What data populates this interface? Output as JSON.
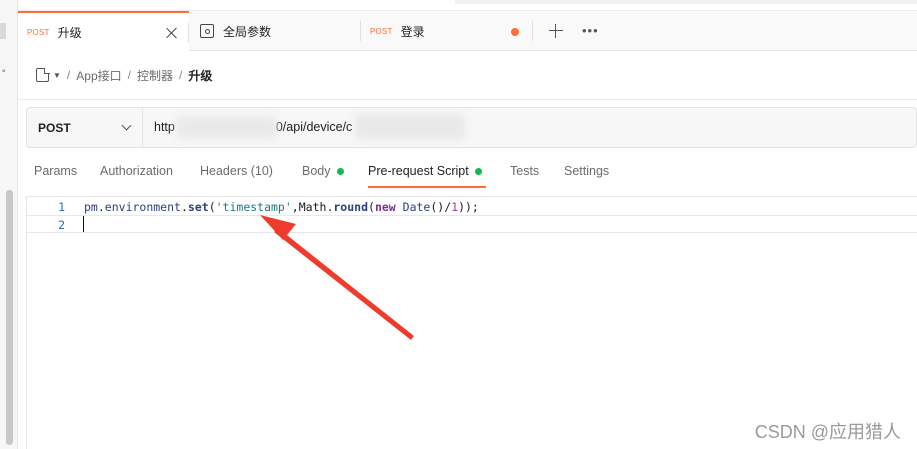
{
  "tabs": [
    {
      "method": "POST",
      "label": "升级",
      "active": true
    },
    {
      "label": "全局参数"
    },
    {
      "method": "POST",
      "label": "登录",
      "unsaved": true
    }
  ],
  "breadcrumb": {
    "items": [
      "App接口",
      "控制器"
    ],
    "current": "升级",
    "separator": "/"
  },
  "request": {
    "method": "POST",
    "url_start": "http",
    "url_middle": "0/api/device/c"
  },
  "request_tabs": [
    {
      "label": "Params"
    },
    {
      "label": "Authorization"
    },
    {
      "label": "Headers (10)"
    },
    {
      "label": "Body",
      "dot": true
    },
    {
      "label": "Pre-request Script",
      "dot": true,
      "active": true
    },
    {
      "label": "Tests"
    },
    {
      "label": "Settings"
    }
  ],
  "editor": {
    "line_numbers": [
      "1",
      "2"
    ],
    "code": {
      "obj": "pm",
      "dot1": ".",
      "prop1": "environment",
      "dot2": ".",
      "prop2": "set",
      "open": "(",
      "str": "'timestamp'",
      "comma": ",",
      "math": "Math",
      "dot3": ".",
      "prop3": "round",
      "open2": "(",
      "kw": "new",
      "cls": " Date",
      "parens": "()",
      "slash": "/",
      "num": "1",
      "close": "));"
    }
  },
  "watermark": "CSDN @应用猎人",
  "colors": {
    "accent": "#ff6c37",
    "green_dot": "#0cbb52",
    "arrow": "#ef3b2c"
  },
  "icons": {
    "close": "close-icon",
    "environment": "environment-icon",
    "plus": "plus-icon",
    "more": "more-icon",
    "document": "document-icon",
    "chevron": "chevron-down-icon"
  }
}
